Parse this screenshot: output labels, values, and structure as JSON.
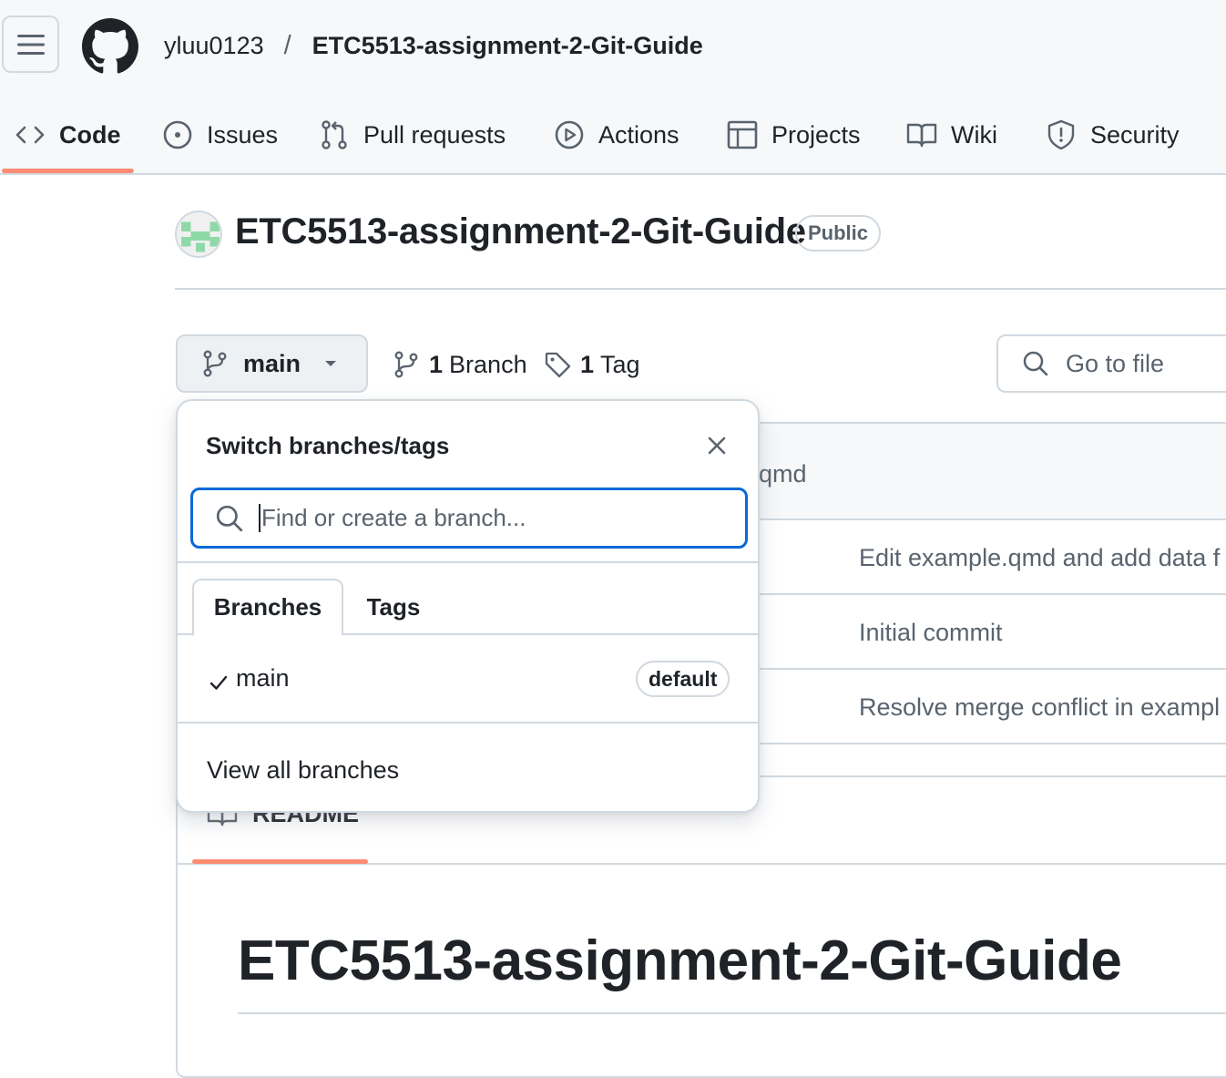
{
  "header": {
    "owner": "yluu0123",
    "separator": "/",
    "repo": "ETC5513-assignment-2-Git-Guide"
  },
  "nav": {
    "code": "Code",
    "issues": "Issues",
    "pull_requests": "Pull requests",
    "actions": "Actions",
    "projects": "Projects",
    "wiki": "Wiki",
    "security": "Security"
  },
  "repo": {
    "title": "ETC5513-assignment-2-Git-Guide",
    "visibility": "Public"
  },
  "branch_bar": {
    "current_branch": "main",
    "branch_count": "1",
    "branch_label": "Branch",
    "tag_count": "1",
    "tag_label": "Tag",
    "go_to_file": "Go to file"
  },
  "files": {
    "header_commit_fragment": "qmd",
    "rows": [
      {
        "message": "Edit example.qmd and add data f"
      },
      {
        "message": "Initial commit"
      },
      {
        "message": "Resolve merge conflict in exampl"
      }
    ]
  },
  "readme": {
    "tab_label": "README",
    "heading": "ETC5513-assignment-2-Git-Guide"
  },
  "dropdown": {
    "title": "Switch branches/tags",
    "search_placeholder": "Find or create a branch...",
    "tabs": [
      "Branches",
      "Tags"
    ],
    "branches": [
      {
        "name": "main",
        "badge": "default",
        "selected": true
      }
    ],
    "view_all": "View all branches"
  },
  "colors": {
    "accent_underline": "#fd8c73",
    "focus_blue": "#0969da",
    "border": "#d1d9e0",
    "header_bg": "#f6f8fa"
  },
  "icons": [
    "hamburger-icon",
    "github-logo-icon",
    "code-icon",
    "issue-icon",
    "pull-request-icon",
    "play-icon",
    "table-icon",
    "book-icon",
    "shield-icon",
    "branch-icon",
    "caret-down-icon",
    "tag-icon",
    "search-icon",
    "close-icon",
    "check-icon"
  ]
}
